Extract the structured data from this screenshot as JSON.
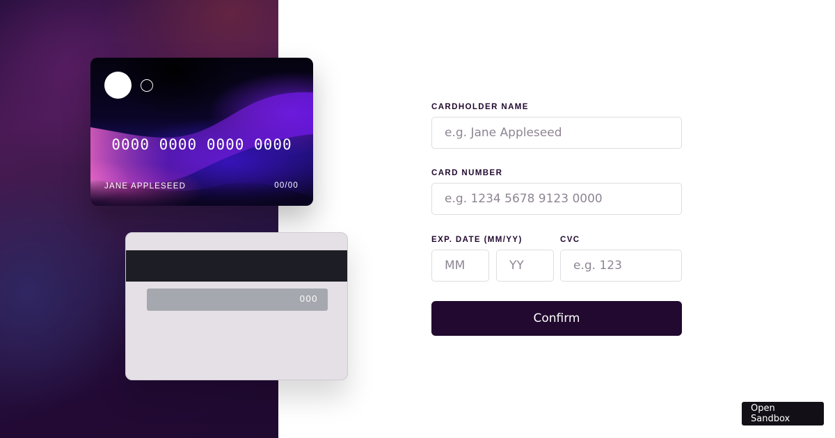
{
  "card_front": {
    "number": "0000 0000 0000 0000",
    "name": "JANE APPLESEED",
    "expiry": "00/00"
  },
  "card_back": {
    "cvc": "000"
  },
  "form": {
    "cardholder_name": {
      "label": "CARDHOLDER NAME",
      "placeholder": "e.g. Jane Appleseed",
      "value": ""
    },
    "card_number": {
      "label": "CARD NUMBER",
      "placeholder": "e.g. 1234 5678 9123 0000",
      "value": ""
    },
    "exp_date": {
      "label": "EXP. DATE (MM/YY)",
      "month_placeholder": "MM",
      "year_placeholder": "YY"
    },
    "cvc": {
      "label": "CVC",
      "placeholder": "e.g. 123"
    },
    "confirm_label": "Confirm"
  },
  "sandbox_button": {
    "label": "Open Sandbox"
  },
  "colors": {
    "primary": "#21092f",
    "input_border": "#dedddf",
    "placeholder": "#8e8593",
    "card_back": "#e4e0e6"
  }
}
